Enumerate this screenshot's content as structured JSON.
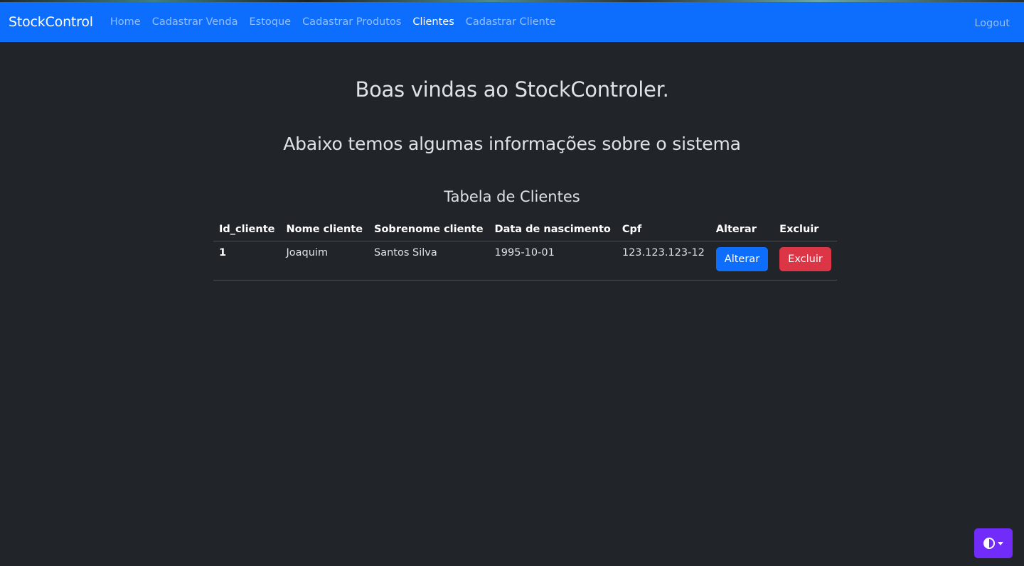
{
  "navbar": {
    "brand": "StockControl",
    "links": [
      {
        "label": "Home"
      },
      {
        "label": "Cadastrar Venda"
      },
      {
        "label": "Estoque"
      },
      {
        "label": "Cadastrar Produtos"
      },
      {
        "label": "Clientes"
      },
      {
        "label": "Cadastrar Cliente"
      }
    ],
    "active_link": "Clientes",
    "logout_label": "Logout",
    "color": "#0d6efd"
  },
  "main": {
    "welcome_title": "Boas vindas ao StockControler.",
    "subtitle": "Abaixo temos algumas informações sobre o sistema",
    "table_title": "Tabela de Clientes",
    "table": {
      "headers": [
        "Id_cliente",
        "Nome cliente",
        "Sobrenome cliente",
        "Data de nascimento",
        "Cpf",
        "Alterar",
        "Excluir"
      ],
      "rows": [
        {
          "id": "1",
          "nome": "Joaquim",
          "sobrenome": "Santos Silva",
          "nascimento": "1995-10-01",
          "cpf": "123.123.123-12",
          "alterar_label": "Alterar",
          "excluir_label": "Excluir"
        }
      ]
    }
  },
  "theme_toggle": {
    "icon": "contrast-half-circle-icon",
    "color": "#712cf9"
  },
  "colors": {
    "background": "#212529",
    "primary": "#0d6efd",
    "danger": "#dc3545"
  }
}
